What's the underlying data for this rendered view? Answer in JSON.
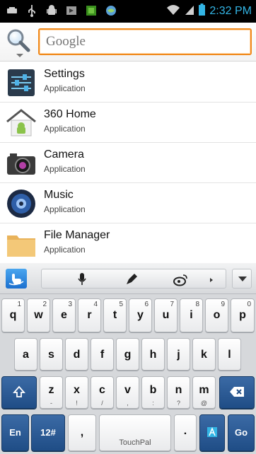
{
  "status_bar": {
    "time": "2:32 PM",
    "left_icons": [
      "notification-icon",
      "usb-icon",
      "android-debug-icon",
      "media-icon",
      "storage-icon",
      "browser-icon"
    ],
    "right_icons": [
      "wifi-icon",
      "signal-icon",
      "battery-icon"
    ],
    "time_color": "#33b5e5"
  },
  "search": {
    "placeholder": "Google",
    "value": ""
  },
  "results": [
    {
      "title": "Settings",
      "subtitle": "Application",
      "icon": "settings-icon"
    },
    {
      "title": "360 Home",
      "subtitle": "Application",
      "icon": "home-icon"
    },
    {
      "title": "Camera",
      "subtitle": "Application",
      "icon": "camera-icon"
    },
    {
      "title": "Music",
      "subtitle": "Application",
      "icon": "music-icon"
    },
    {
      "title": "File Manager",
      "subtitle": "Application",
      "icon": "folder-icon"
    }
  ],
  "keyboard": {
    "toolbar_icons": [
      "touchpal-icon",
      "mic-icon",
      "pen-icon",
      "weibo-icon",
      "collapse-keyboard-icon"
    ],
    "row1": [
      {
        "key": "q",
        "hint": "1"
      },
      {
        "key": "w",
        "hint": "2"
      },
      {
        "key": "e",
        "hint": "3"
      },
      {
        "key": "r",
        "hint": "4"
      },
      {
        "key": "t",
        "hint": "5"
      },
      {
        "key": "y",
        "hint": "6"
      },
      {
        "key": "u",
        "hint": "7"
      },
      {
        "key": "i",
        "hint": "8"
      },
      {
        "key": "o",
        "hint": "9"
      },
      {
        "key": "p",
        "hint": "0"
      }
    ],
    "row2": [
      "a",
      "s",
      "d",
      "f",
      "g",
      "h",
      "j",
      "k",
      "l"
    ],
    "row3": [
      {
        "key": "z",
        "sub": "-"
      },
      {
        "key": "x",
        "sub": "!"
      },
      {
        "key": "c",
        "sub": "/"
      },
      {
        "key": "v",
        "sub": ","
      },
      {
        "key": "b",
        "sub": ":"
      },
      {
        "key": "n",
        "sub": "?"
      },
      {
        "key": "m",
        "sub": "@"
      }
    ],
    "bottom": {
      "lang": "En",
      "symbols": "12#",
      "comma": ",",
      "space": "TouchPal",
      "period": ".",
      "go": "Go"
    }
  }
}
